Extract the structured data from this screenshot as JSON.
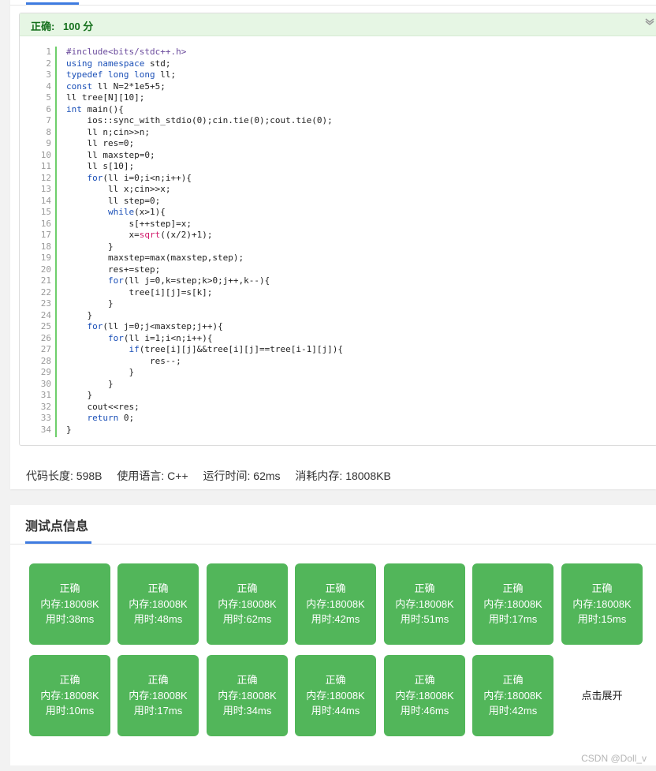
{
  "result": {
    "label": "正确:",
    "score": "100 分"
  },
  "code_lines": [
    [
      [
        "pp",
        "#include<bits/stdc++.h>"
      ]
    ],
    [
      [
        "kw",
        "using"
      ],
      [
        "t",
        " "
      ],
      [
        "kw",
        "namespace"
      ],
      [
        "t",
        " std;"
      ]
    ],
    [
      [
        "kw",
        "typedef"
      ],
      [
        "t",
        " "
      ],
      [
        "ty",
        "long long"
      ],
      [
        "t",
        " ll;"
      ]
    ],
    [
      [
        "kw",
        "const"
      ],
      [
        "t",
        " ll N=2*1e5+5;"
      ]
    ],
    [
      [
        "t",
        "ll tree[N][10];"
      ]
    ],
    [
      [
        "ty",
        "int"
      ],
      [
        "t",
        " main(){"
      ]
    ],
    [
      [
        "t",
        "    ios::sync_with_stdio(0);cin.tie(0);cout.tie(0);"
      ]
    ],
    [
      [
        "t",
        "    ll n;cin>>n;"
      ]
    ],
    [
      [
        "t",
        "    ll res=0;"
      ]
    ],
    [
      [
        "t",
        "    ll maxstep=0;"
      ]
    ],
    [
      [
        "t",
        "    ll s[10];"
      ]
    ],
    [
      [
        "t",
        "    "
      ],
      [
        "kw",
        "for"
      ],
      [
        "t",
        "(ll i=0;i<n;i++){"
      ]
    ],
    [
      [
        "t",
        "        ll x;cin>>x;"
      ]
    ],
    [
      [
        "t",
        "        ll step=0;"
      ]
    ],
    [
      [
        "t",
        "        "
      ],
      [
        "kw",
        "while"
      ],
      [
        "t",
        "(x>1){"
      ]
    ],
    [
      [
        "t",
        "            s[++step]=x;"
      ]
    ],
    [
      [
        "t",
        "            x="
      ],
      [
        "fn",
        "sqrt"
      ],
      [
        "t",
        "((x/2)+1);"
      ]
    ],
    [
      [
        "t",
        "        }"
      ]
    ],
    [
      [
        "t",
        "        maxstep=max(maxstep,step);"
      ]
    ],
    [
      [
        "t",
        "        res+=step;"
      ]
    ],
    [
      [
        "t",
        "        "
      ],
      [
        "kw",
        "for"
      ],
      [
        "t",
        "(ll j=0,k=step;k>0;j++,k--){"
      ]
    ],
    [
      [
        "t",
        "            tree[i][j]=s[k];"
      ]
    ],
    [
      [
        "t",
        "        }"
      ]
    ],
    [
      [
        "t",
        "    }"
      ]
    ],
    [
      [
        "t",
        "    "
      ],
      [
        "kw",
        "for"
      ],
      [
        "t",
        "(ll j=0;j<maxstep;j++){"
      ]
    ],
    [
      [
        "t",
        "        "
      ],
      [
        "kw",
        "for"
      ],
      [
        "t",
        "(ll i=1;i<n;i++){"
      ]
    ],
    [
      [
        "t",
        "            "
      ],
      [
        "kw",
        "if"
      ],
      [
        "t",
        "(tree[i][j]&&tree[i][j]==tree[i-1][j]){"
      ]
    ],
    [
      [
        "t",
        "                res--;"
      ]
    ],
    [
      [
        "t",
        "            }"
      ]
    ],
    [
      [
        "t",
        "        }"
      ]
    ],
    [
      [
        "t",
        "    }"
      ]
    ],
    [
      [
        "t",
        "    cout<<res;"
      ]
    ],
    [
      [
        "t",
        "    "
      ],
      [
        "kw",
        "return"
      ],
      [
        "t",
        " 0;"
      ]
    ],
    [
      [
        "t",
        "}"
      ]
    ]
  ],
  "line_numbers": [
    "1",
    "2",
    "3",
    "4",
    "5",
    "6",
    "7",
    "8",
    "9",
    "10",
    "11",
    "12",
    "13",
    "14",
    "15",
    "16",
    "17",
    "18",
    "19",
    "20",
    "21",
    "22",
    "23",
    "24",
    "25",
    "26",
    "27",
    "28",
    "29",
    "30",
    "31",
    "32",
    "33",
    "34"
  ],
  "stats": {
    "code_length": "代码长度: 598B",
    "language": "使用语言: C++",
    "run_time": "运行时间: 62ms",
    "memory": "消耗内存: 18008KB"
  },
  "testcases": {
    "title": "测试点信息",
    "items": [
      {
        "status": "正确",
        "memory": "内存:18008K",
        "time": "用时:38ms"
      },
      {
        "status": "正确",
        "memory": "内存:18008K",
        "time": "用时:48ms"
      },
      {
        "status": "正确",
        "memory": "内存:18008K",
        "time": "用时:62ms"
      },
      {
        "status": "正确",
        "memory": "内存:18008K",
        "time": "用时:42ms"
      },
      {
        "status": "正确",
        "memory": "内存:18008K",
        "time": "用时:51ms"
      },
      {
        "status": "正确",
        "memory": "内存:18008K",
        "time": "用时:17ms"
      },
      {
        "status": "正确",
        "memory": "内存:18008K",
        "time": "用时:15ms"
      },
      {
        "status": "正确",
        "memory": "内存:18008K",
        "time": "用时:10ms"
      },
      {
        "status": "正确",
        "memory": "内存:18008K",
        "time": "用时:17ms"
      },
      {
        "status": "正确",
        "memory": "内存:18008K",
        "time": "用时:34ms"
      },
      {
        "status": "正确",
        "memory": "内存:18008K",
        "time": "用时:44ms"
      },
      {
        "status": "正确",
        "memory": "内存:18008K",
        "time": "用时:46ms"
      },
      {
        "status": "正确",
        "memory": "内存:18008K",
        "time": "用时:42ms"
      }
    ],
    "expand_label": "点击展开"
  },
  "watermark": "CSDN @Doll_v",
  "colors": {
    "accent": "#3e7be0",
    "success": "#52b65a",
    "result_bg": "#e6f6e4",
    "result_text": "#15701c"
  },
  "icons": {
    "collapse": "chevron-down-icon"
  }
}
